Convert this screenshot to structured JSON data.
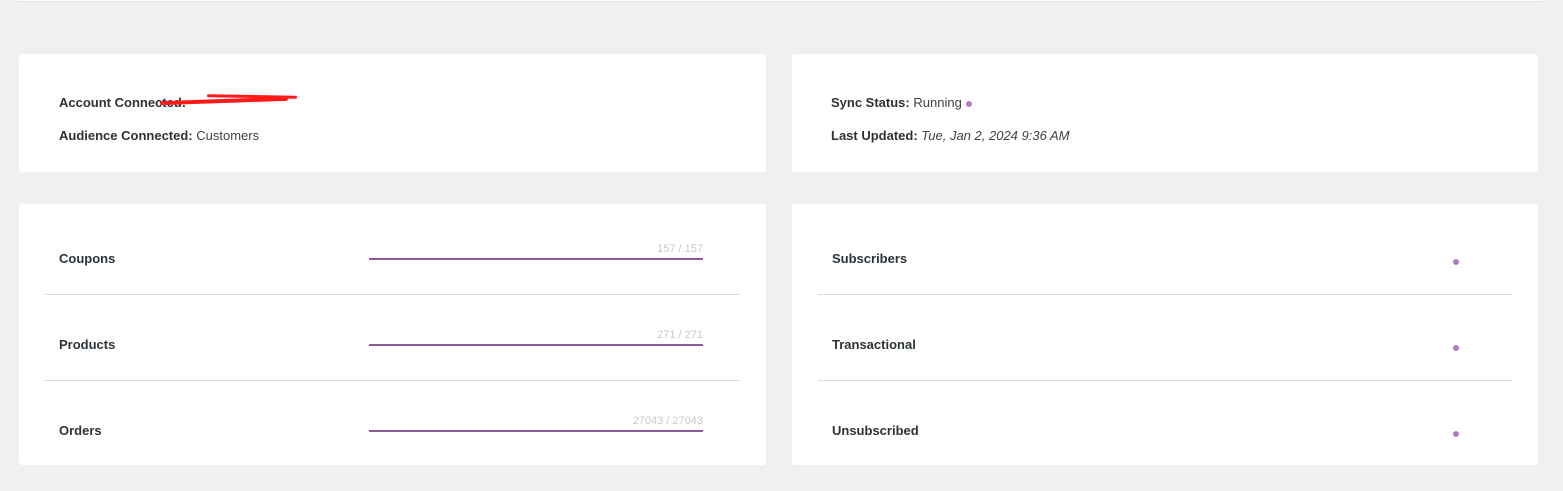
{
  "account": {
    "connected_label": "Account Connected:",
    "connected_value": "",
    "audience_label": "Audience Connected:",
    "audience_value": "Customers"
  },
  "sync": {
    "status_label": "Sync Status:",
    "status_value": "Running",
    "updated_label": "Last Updated:",
    "updated_value": "Tue, Jan 2, 2024 9:36 AM"
  },
  "progress_rows": [
    {
      "label": "Coupons",
      "count_text": "157 / 157",
      "fraction": 1.0
    },
    {
      "label": "Products",
      "count_text": "271 / 271",
      "fraction": 1.0
    },
    {
      "label": "Orders",
      "count_text": "27043 / 27043",
      "fraction": 1.0
    }
  ],
  "subscriber_rows": [
    {
      "label": "Subscribers"
    },
    {
      "label": "Transactional"
    },
    {
      "label": "Unsubscribed"
    }
  ],
  "colors": {
    "accent": "#8a5d9a",
    "dot": "#b07cc0",
    "redaction": "#ff1a1a",
    "background": "#f0f0f1"
  }
}
